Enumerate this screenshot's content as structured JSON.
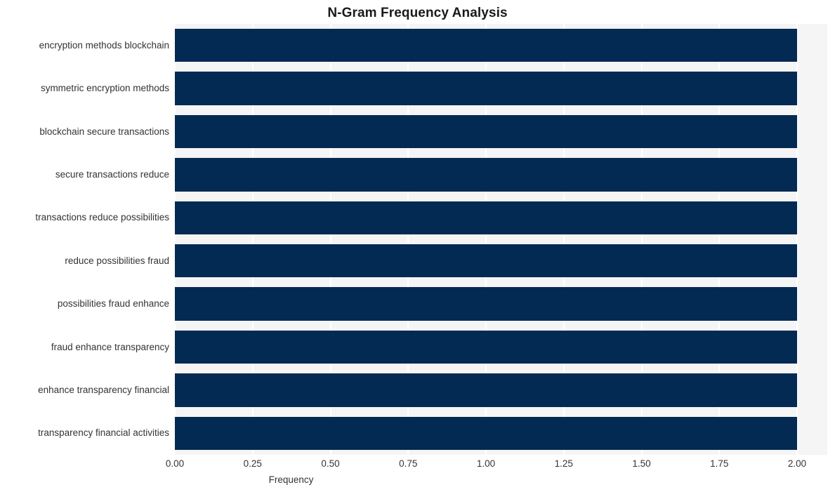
{
  "chart_data": {
    "type": "bar",
    "orientation": "horizontal",
    "title": "N-Gram Frequency Analysis",
    "xlabel": "Frequency",
    "ylabel": "",
    "categories": [
      "encryption methods blockchain",
      "symmetric encryption methods",
      "blockchain secure transactions",
      "secure transactions reduce",
      "transactions reduce possibilities",
      "reduce possibilities fraud",
      "possibilities fraud enhance",
      "fraud enhance transparency",
      "enhance transparency financial",
      "transparency financial activities"
    ],
    "values": [
      2,
      2,
      2,
      2,
      2,
      2,
      2,
      2,
      2,
      2
    ],
    "xlim": [
      0,
      2
    ],
    "xticks": [
      0,
      0.25,
      0.5,
      0.75,
      1,
      1.25,
      1.5,
      1.75,
      2
    ],
    "xtick_labels": [
      "0.00",
      "0.25",
      "0.50",
      "0.75",
      "1.00",
      "1.25",
      "1.50",
      "1.75",
      "2.00"
    ],
    "grid": true,
    "grid_axis": "x",
    "legend": false,
    "bar_color": "#022a52",
    "plot_background": "#f5f5f5",
    "figure_background": "#ffffff",
    "gridline_color": "#ffffff",
    "text_color": "#333333",
    "title_color": "#1a1a1a"
  }
}
